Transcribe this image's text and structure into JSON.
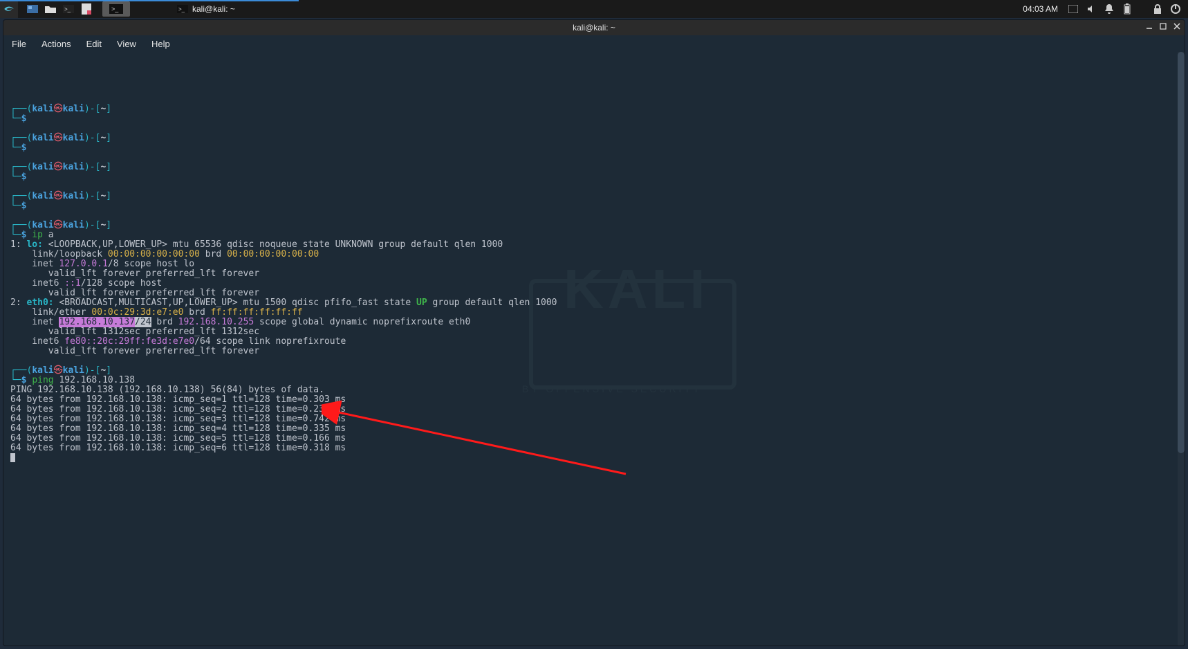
{
  "panel": {
    "taskbar_title": "kali@kali: ~",
    "clock": "04:03 AM"
  },
  "window": {
    "title": "kali@kali: ~",
    "menus": [
      "File",
      "Actions",
      "Edit",
      "View",
      "Help"
    ]
  },
  "prompt": {
    "user": "kali",
    "sep": "㉿",
    "host": "kali",
    "path": "~",
    "symbol": "$"
  },
  "commands": {
    "ip_a": "ip a",
    "ping_cmd": "ping",
    "ping_target": "192.168.10.138"
  },
  "ip_output": {
    "iface1_label": "1:",
    "iface1_name": "lo:",
    "iface1_flags": "<LOOPBACK,UP,LOWER_UP> mtu 65536 qdisc noqueue state UNKNOWN group default qlen 1000",
    "lo_link_pre": "    link/loopback ",
    "lo_mac": "00:00:00:00:00:00",
    "lo_brd_lbl": " brd ",
    "lo_brd": "00:00:00:00:00:00",
    "lo_inet_pre": "    inet ",
    "lo_inet_ip": "127.0.0.1",
    "lo_inet_suf": "/8 scope host lo",
    "lo_valid": "       valid_lft forever preferred_lft forever",
    "lo_inet6_pre": "    inet6 ",
    "lo_inet6_ip": "::1",
    "lo_inet6_suf": "/128 scope host",
    "iface2_label": "2:",
    "iface2_name": "eth0:",
    "iface2_flags_a": "<BROADCAST,MULTICAST,UP,LOWER_UP> mtu 1500 qdisc pfifo_fast state ",
    "iface2_state": "UP",
    "iface2_flags_b": " group default qlen 1000",
    "eth_link_pre": "    link/ether ",
    "eth_mac": "00:0c:29:3d:e7:e0",
    "eth_brd_lbl": " brd ",
    "eth_brd": "ff:ff:ff:ff:ff:ff",
    "eth_inet_pre": "    inet ",
    "eth_inet_ip": "192.168.10.137",
    "eth_inet_mask": "/24",
    "eth_inet_brd_lbl": " brd ",
    "eth_inet_brd": "192.168.10.255",
    "eth_inet_suf": " scope global dynamic noprefixroute eth0",
    "eth_valid": "       valid_lft 1312sec preferred_lft 1312sec",
    "eth_inet6_pre": "    inet6 ",
    "eth_inet6_ip": "fe80::20c:29ff:fe3d:e7e0",
    "eth_inet6_suf": "/64 scope link noprefixroute",
    "eth_valid2": "       valid_lft forever preferred_lft forever"
  },
  "ping_output": {
    "header": "PING 192.168.10.138 (192.168.10.138) 56(84) bytes of data.",
    "lines": [
      "64 bytes from 192.168.10.138: icmp_seq=1 ttl=128 time=0.303 ms",
      "64 bytes from 192.168.10.138: icmp_seq=2 ttl=128 time=0.231 ms",
      "64 bytes from 192.168.10.138: icmp_seq=3 ttl=128 time=0.742 ms",
      "64 bytes from 192.168.10.138: icmp_seq=4 ttl=128 time=0.335 ms",
      "64 bytes from 192.168.10.138: icmp_seq=5 ttl=128 time=0.166 ms",
      "64 bytes from 192.168.10.138: icmp_seq=6 ttl=128 time=0.318 ms"
    ]
  },
  "watermark": {
    "brand": "KALI",
    "tagline": "BY OFFENSIVE SECURITY"
  }
}
